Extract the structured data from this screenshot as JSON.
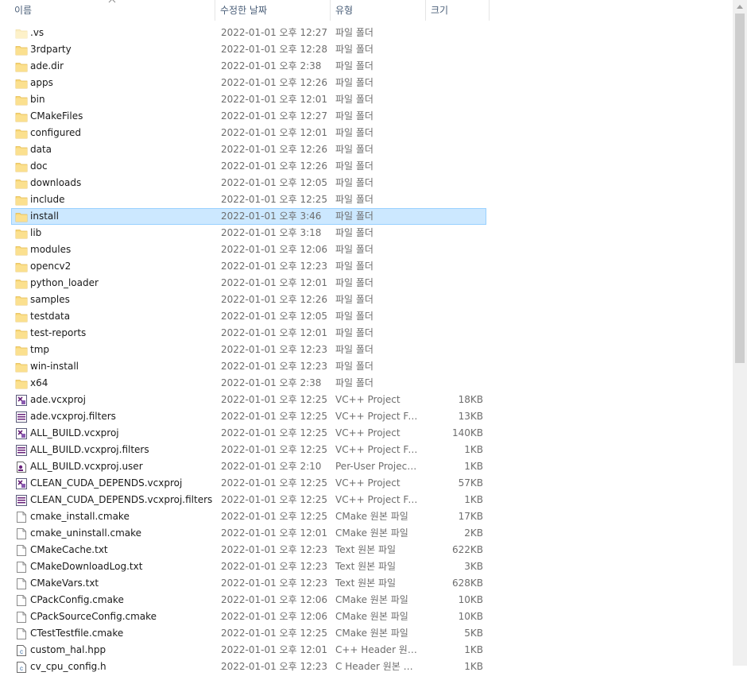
{
  "columns": {
    "name": "이름",
    "date": "수정한 날짜",
    "type": "유형",
    "size": "크기"
  },
  "icons": {
    "folder": "folder-icon",
    "vcxproj": "vcxproj-icon",
    "filters": "filters-icon",
    "user": "user-file-icon",
    "doc": "document-icon",
    "cheader": "c-header-icon"
  },
  "colors": {
    "folder": "#f8d775",
    "selection": "#cce8ff",
    "selection_border": "#99d1ff",
    "header_text": "#4c607a"
  },
  "selected_index": 11,
  "files": [
    {
      "name": ".vs",
      "date": "2022-01-01 오후 12:27",
      "type": "파일 폴더",
      "size": "",
      "icon": "folder",
      "faded": true
    },
    {
      "name": "3rdparty",
      "date": "2022-01-01 오후 12:28",
      "type": "파일 폴더",
      "size": "",
      "icon": "folder"
    },
    {
      "name": "ade.dir",
      "date": "2022-01-01 오후 2:38",
      "type": "파일 폴더",
      "size": "",
      "icon": "folder"
    },
    {
      "name": "apps",
      "date": "2022-01-01 오후 12:26",
      "type": "파일 폴더",
      "size": "",
      "icon": "folder"
    },
    {
      "name": "bin",
      "date": "2022-01-01 오후 12:01",
      "type": "파일 폴더",
      "size": "",
      "icon": "folder"
    },
    {
      "name": "CMakeFiles",
      "date": "2022-01-01 오후 12:27",
      "type": "파일 폴더",
      "size": "",
      "icon": "folder"
    },
    {
      "name": "configured",
      "date": "2022-01-01 오후 12:01",
      "type": "파일 폴더",
      "size": "",
      "icon": "folder"
    },
    {
      "name": "data",
      "date": "2022-01-01 오후 12:26",
      "type": "파일 폴더",
      "size": "",
      "icon": "folder"
    },
    {
      "name": "doc",
      "date": "2022-01-01 오후 12:26",
      "type": "파일 폴더",
      "size": "",
      "icon": "folder"
    },
    {
      "name": "downloads",
      "date": "2022-01-01 오후 12:05",
      "type": "파일 폴더",
      "size": "",
      "icon": "folder"
    },
    {
      "name": "include",
      "date": "2022-01-01 오후 12:25",
      "type": "파일 폴더",
      "size": "",
      "icon": "folder"
    },
    {
      "name": "install",
      "date": "2022-01-01 오후 3:46",
      "type": "파일 폴더",
      "size": "",
      "icon": "folder"
    },
    {
      "name": "lib",
      "date": "2022-01-01 오후 3:18",
      "type": "파일 폴더",
      "size": "",
      "icon": "folder"
    },
    {
      "name": "modules",
      "date": "2022-01-01 오후 12:06",
      "type": "파일 폴더",
      "size": "",
      "icon": "folder"
    },
    {
      "name": "opencv2",
      "date": "2022-01-01 오후 12:23",
      "type": "파일 폴더",
      "size": "",
      "icon": "folder"
    },
    {
      "name": "python_loader",
      "date": "2022-01-01 오후 12:01",
      "type": "파일 폴더",
      "size": "",
      "icon": "folder"
    },
    {
      "name": "samples",
      "date": "2022-01-01 오후 12:26",
      "type": "파일 폴더",
      "size": "",
      "icon": "folder"
    },
    {
      "name": "testdata",
      "date": "2022-01-01 오후 12:05",
      "type": "파일 폴더",
      "size": "",
      "icon": "folder"
    },
    {
      "name": "test-reports",
      "date": "2022-01-01 오후 12:01",
      "type": "파일 폴더",
      "size": "",
      "icon": "folder"
    },
    {
      "name": "tmp",
      "date": "2022-01-01 오후 12:23",
      "type": "파일 폴더",
      "size": "",
      "icon": "folder"
    },
    {
      "name": "win-install",
      "date": "2022-01-01 오후 12:23",
      "type": "파일 폴더",
      "size": "",
      "icon": "folder"
    },
    {
      "name": "x64",
      "date": "2022-01-01 오후 2:38",
      "type": "파일 폴더",
      "size": "",
      "icon": "folder"
    },
    {
      "name": "ade.vcxproj",
      "date": "2022-01-01 오후 12:25",
      "type": "VC++ Project",
      "size": "18KB",
      "icon": "vcxproj"
    },
    {
      "name": "ade.vcxproj.filters",
      "date": "2022-01-01 오후 12:25",
      "type": "VC++ Project Filt...",
      "size": "13KB",
      "icon": "filters"
    },
    {
      "name": "ALL_BUILD.vcxproj",
      "date": "2022-01-01 오후 12:25",
      "type": "VC++ Project",
      "size": "140KB",
      "icon": "vcxproj"
    },
    {
      "name": "ALL_BUILD.vcxproj.filters",
      "date": "2022-01-01 오후 12:25",
      "type": "VC++ Project Filt...",
      "size": "1KB",
      "icon": "filters"
    },
    {
      "name": "ALL_BUILD.vcxproj.user",
      "date": "2022-01-01 오후 2:10",
      "type": "Per-User Project ...",
      "size": "1KB",
      "icon": "user"
    },
    {
      "name": "CLEAN_CUDA_DEPENDS.vcxproj",
      "date": "2022-01-01 오후 12:25",
      "type": "VC++ Project",
      "size": "57KB",
      "icon": "vcxproj"
    },
    {
      "name": "CLEAN_CUDA_DEPENDS.vcxproj.filters",
      "date": "2022-01-01 오후 12:25",
      "type": "VC++ Project Filt...",
      "size": "1KB",
      "icon": "filters"
    },
    {
      "name": "cmake_install.cmake",
      "date": "2022-01-01 오후 12:25",
      "type": "CMake 원본 파일",
      "size": "17KB",
      "icon": "doc"
    },
    {
      "name": "cmake_uninstall.cmake",
      "date": "2022-01-01 오후 12:01",
      "type": "CMake 원본 파일",
      "size": "2KB",
      "icon": "doc"
    },
    {
      "name": "CMakeCache.txt",
      "date": "2022-01-01 오후 12:23",
      "type": "Text 원본 파일",
      "size": "622KB",
      "icon": "doc"
    },
    {
      "name": "CMakeDownloadLog.txt",
      "date": "2022-01-01 오후 12:23",
      "type": "Text 원본 파일",
      "size": "3KB",
      "icon": "doc"
    },
    {
      "name": "CMakeVars.txt",
      "date": "2022-01-01 오후 12:23",
      "type": "Text 원본 파일",
      "size": "628KB",
      "icon": "doc"
    },
    {
      "name": "CPackConfig.cmake",
      "date": "2022-01-01 오후 12:06",
      "type": "CMake 원본 파일",
      "size": "10KB",
      "icon": "doc"
    },
    {
      "name": "CPackSourceConfig.cmake",
      "date": "2022-01-01 오후 12:06",
      "type": "CMake 원본 파일",
      "size": "10KB",
      "icon": "doc"
    },
    {
      "name": "CTestTestfile.cmake",
      "date": "2022-01-01 오후 12:25",
      "type": "CMake 원본 파일",
      "size": "5KB",
      "icon": "doc"
    },
    {
      "name": "custom_hal.hpp",
      "date": "2022-01-01 오후 12:01",
      "type": "C++ Header 원본...",
      "size": "1KB",
      "icon": "cheader"
    },
    {
      "name": "cv_cpu_config.h",
      "date": "2022-01-01 오후 12:23",
      "type": "C Header 원본 파일",
      "size": "1KB",
      "icon": "cheader"
    }
  ]
}
